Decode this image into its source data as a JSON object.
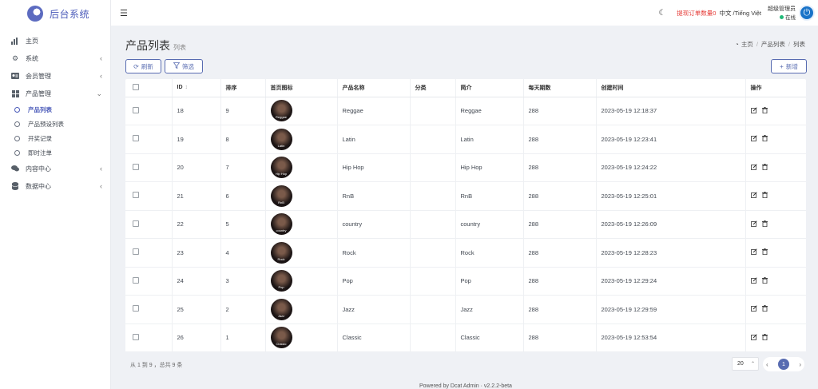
{
  "brand": {
    "title": "后台系统"
  },
  "sidebar": {
    "items": [
      {
        "label": "主页",
        "icon": "bar-chart-icon"
      },
      {
        "label": "系统",
        "icon": "gear-icon"
      },
      {
        "label": "会员管理",
        "icon": "id-card-icon"
      },
      {
        "label": "产品管理",
        "icon": "grid-icon"
      },
      {
        "label": "内容中心",
        "icon": "comments-icon"
      },
      {
        "label": "数据中心",
        "icon": "database-icon"
      }
    ],
    "submenu": [
      {
        "label": "产品列表",
        "active": true
      },
      {
        "label": "产品预设列表",
        "active": false
      },
      {
        "label": "开奖记录",
        "active": false
      },
      {
        "label": "即时注单",
        "active": false
      }
    ]
  },
  "topbar": {
    "alert": "提现订单数量0",
    "lang": "中文 /Tiếng Việt",
    "user_name": "超级管理员",
    "user_status": "在线"
  },
  "page": {
    "title": "产品列表",
    "subtitle": "列表",
    "breadcrumb": [
      "主页",
      "产品列表",
      "列表"
    ]
  },
  "toolbar": {
    "refresh_label": "刷新",
    "filter_label": "筛选",
    "add_label": "新增"
  },
  "table": {
    "columns": [
      "ID",
      "排序",
      "首页图标",
      "产品名称",
      "分类",
      "简介",
      "每天期数",
      "创建时间",
      "操作"
    ],
    "rows": [
      {
        "id": "18",
        "sort": "9",
        "thumb": "Reggae",
        "name": "Reggae",
        "category": "",
        "intro": "Reggae",
        "periods": "288",
        "created": "2023-05-19 12:18:37"
      },
      {
        "id": "19",
        "sort": "8",
        "thumb": "Latin",
        "name": "Latin",
        "category": "",
        "intro": "Latin",
        "periods": "288",
        "created": "2023-05-19 12:23:41"
      },
      {
        "id": "20",
        "sort": "7",
        "thumb": "Hip Hop",
        "name": "Hip Hop",
        "category": "",
        "intro": "Hip Hop",
        "periods": "288",
        "created": "2023-05-19 12:24:22"
      },
      {
        "id": "21",
        "sort": "6",
        "thumb": "RnB",
        "name": "RnB",
        "category": "",
        "intro": "RnB",
        "periods": "288",
        "created": "2023-05-19 12:25:01"
      },
      {
        "id": "22",
        "sort": "5",
        "thumb": "country",
        "name": "country",
        "category": "",
        "intro": "country",
        "periods": "288",
        "created": "2023-05-19 12:26:09"
      },
      {
        "id": "23",
        "sort": "4",
        "thumb": "Rock",
        "name": "Rock",
        "category": "",
        "intro": "Rock",
        "periods": "288",
        "created": "2023-05-19 12:28:23"
      },
      {
        "id": "24",
        "sort": "3",
        "thumb": "Pop",
        "name": "Pop",
        "category": "",
        "intro": "Pop",
        "periods": "288",
        "created": "2023-05-19 12:29:24"
      },
      {
        "id": "25",
        "sort": "2",
        "thumb": "Jazz",
        "name": "Jazz",
        "category": "",
        "intro": "Jazz",
        "periods": "288",
        "created": "2023-05-19 12:29:59"
      },
      {
        "id": "26",
        "sort": "1",
        "thumb": "Classic",
        "name": "Classic",
        "category": "",
        "intro": "Classic",
        "periods": "288",
        "created": "2023-05-19 12:53:54"
      }
    ]
  },
  "footer": {
    "summary": "从 1 到 9 ，总共 9 条",
    "page_size": "20",
    "current_page": "1",
    "powered": "Powered by Dcat Admin · v2.2.2-beta"
  },
  "colors": {
    "accent": "#586cb1",
    "alert": "#e53935",
    "online": "#21b978"
  }
}
